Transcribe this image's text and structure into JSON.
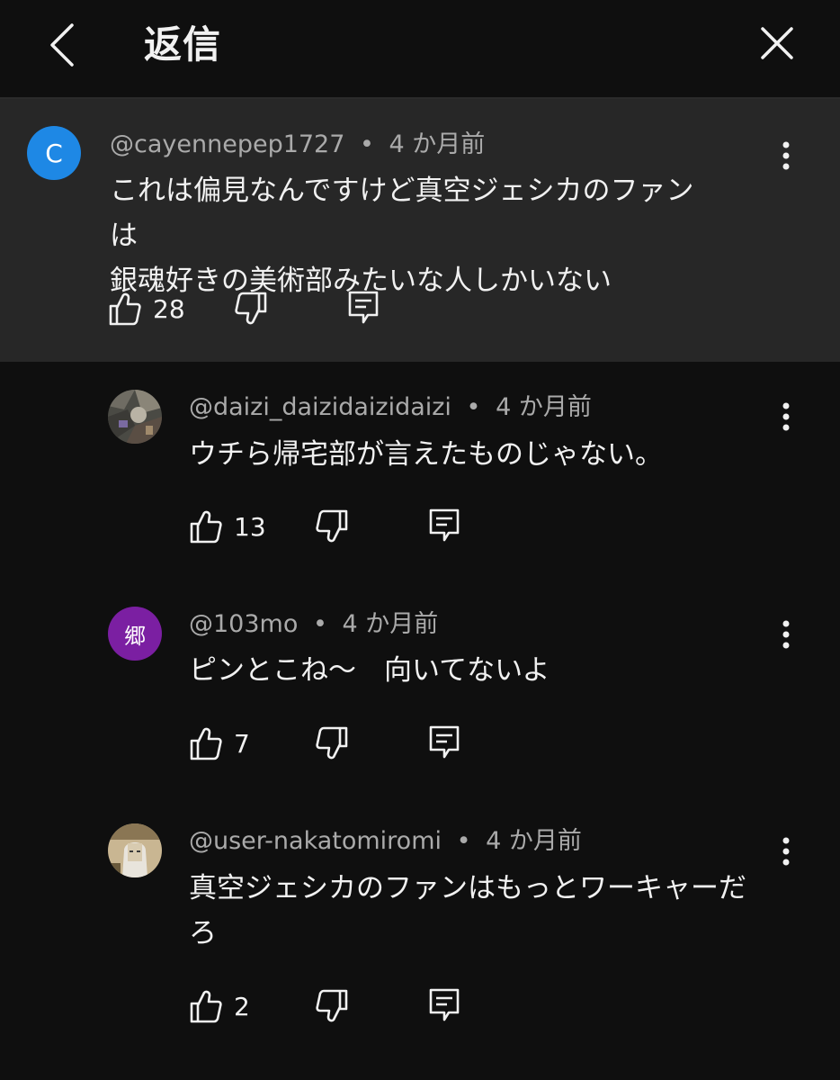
{
  "header": {
    "title": "返信"
  },
  "parent_comment": {
    "avatar_letter": "C",
    "avatar_color": "#1e88e5",
    "author": "@cayennepep1727",
    "separator": "•",
    "time": "4 か月前",
    "text_line1": "これは偏見なんですけど真空ジェシカのファンは",
    "text_line2": "銀魂好きの美術部みたいな人しかいない",
    "likes": "28"
  },
  "replies": [
    {
      "author": "@daizi_daizidaizidaizi",
      "separator": "•",
      "time": "4 か月前",
      "text_line1": "ウチら帰宅部が言えたものじゃない。",
      "likes": "13"
    },
    {
      "avatar_letter": "郷",
      "avatar_color": "#7b1fa2",
      "author": "@103mo",
      "separator": "•",
      "time": "4 か月前",
      "text_line1": "ピンとこね〜　向いてないよ",
      "likes": "7"
    },
    {
      "author": "@user-nakatomiromi",
      "separator": "•",
      "time": "4 か月前",
      "text_line1": "真空ジェシカのファンはもっとワーキャーだ",
      "text_line2": "ろ",
      "likes": "2"
    }
  ]
}
